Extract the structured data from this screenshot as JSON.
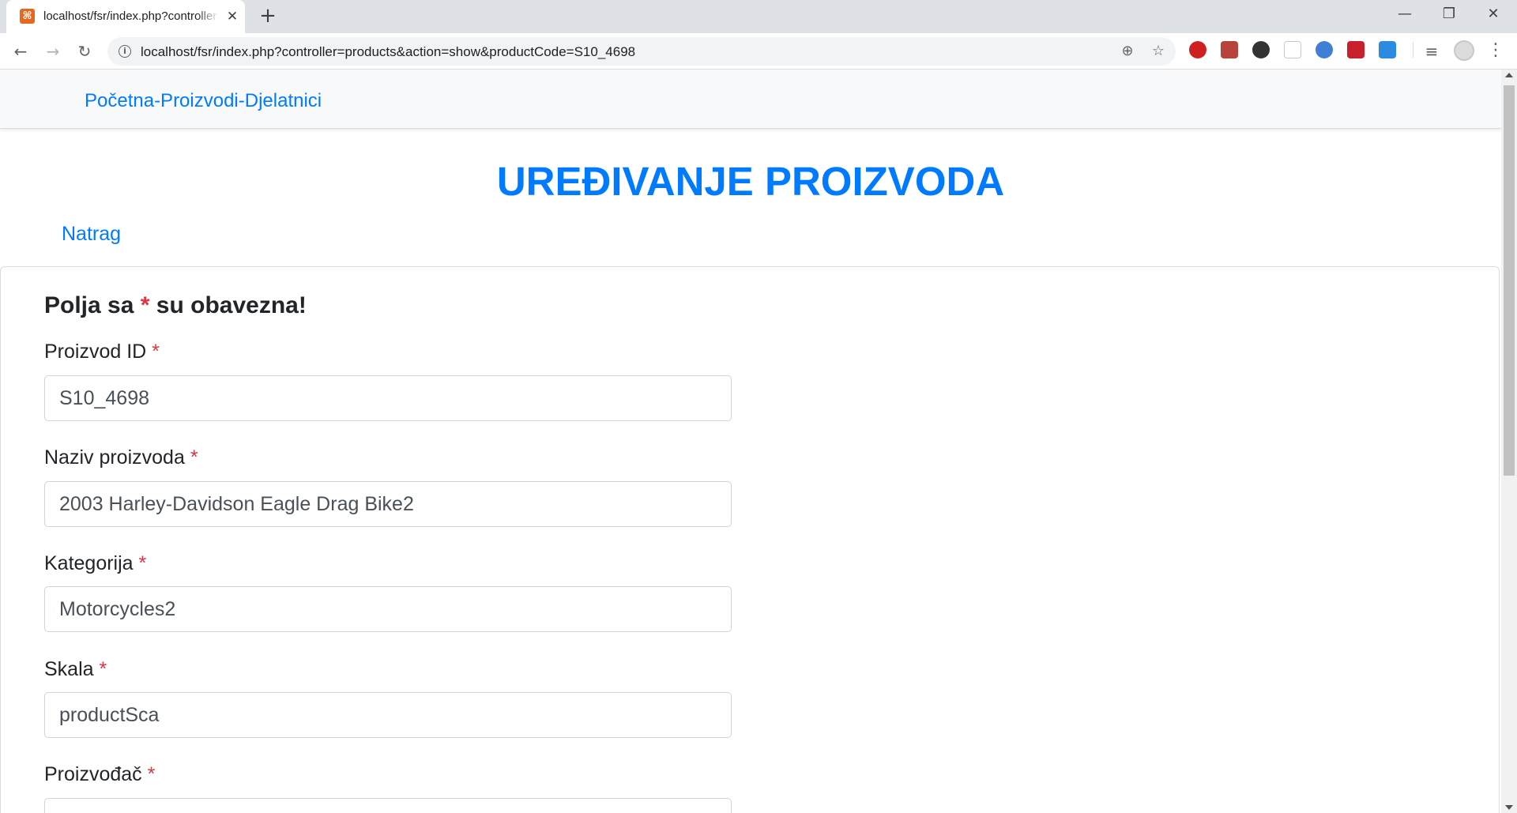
{
  "browser": {
    "tab_title": "localhost/fsr/index.php?controller=products&action=show&productCode=S10_4698",
    "url": "localhost/fsr/index.php?controller=products&action=show&productCode=S10_4698",
    "icons": {
      "favicon": "xampp-icon",
      "close_tab": "close-icon",
      "new_tab": "plus-icon",
      "back": "arrow-left-icon",
      "forward": "arrow-right-icon",
      "reload": "reload-icon",
      "site_info": "info-icon",
      "zoom": "zoom-icon",
      "bookmark": "star-icon"
    },
    "glyphs": {
      "favicon": "⌘",
      "close_tab": "✕",
      "new_tab": "+",
      "minimize": "—",
      "maximize": "❐",
      "close_window": "✕",
      "back": "←",
      "forward": "→",
      "reload": "↻",
      "info": "i",
      "zoom": "⊕",
      "star": "☆",
      "media": "≡",
      "menu": "⋮"
    },
    "extensions": [
      "adblock-icon",
      "pdf-icon",
      "spy-icon",
      "page-icon",
      "globe-icon",
      "video-icon",
      "download-icon"
    ],
    "colors": {
      "extension_red": "#d01f1f",
      "extension_pdf": "#b8433a",
      "extension_blue": "#3f7fd6",
      "extension_download": "#2b8be0"
    }
  },
  "page": {
    "nav_link": "Početna-Proizvodi-Djelatnici",
    "title": "UREĐIVANJE PROIZVODA",
    "back_link": "Natrag",
    "required_note": {
      "prefix": "Polja sa",
      "star": "*",
      "suffix": "su obavezna!"
    },
    "fields": [
      {
        "label": "Proizvod ID",
        "required": "*",
        "value": "S10_4698"
      },
      {
        "label": "Naziv proizvoda",
        "required": "*",
        "value": "2003 Harley-Davidson Eagle Drag Bike2"
      },
      {
        "label": "Kategorija",
        "required": "*",
        "value": "Motorcycles2"
      },
      {
        "label": "Skala",
        "required": "*",
        "value": "productSca"
      },
      {
        "label": "Proizvođač",
        "required": "*",
        "value": ""
      }
    ],
    "colors": {
      "link": "#007bff",
      "required": "#dc3545",
      "text": "#212529",
      "input_text": "#495057",
      "navbar_bg": "#f8f9fa"
    }
  }
}
